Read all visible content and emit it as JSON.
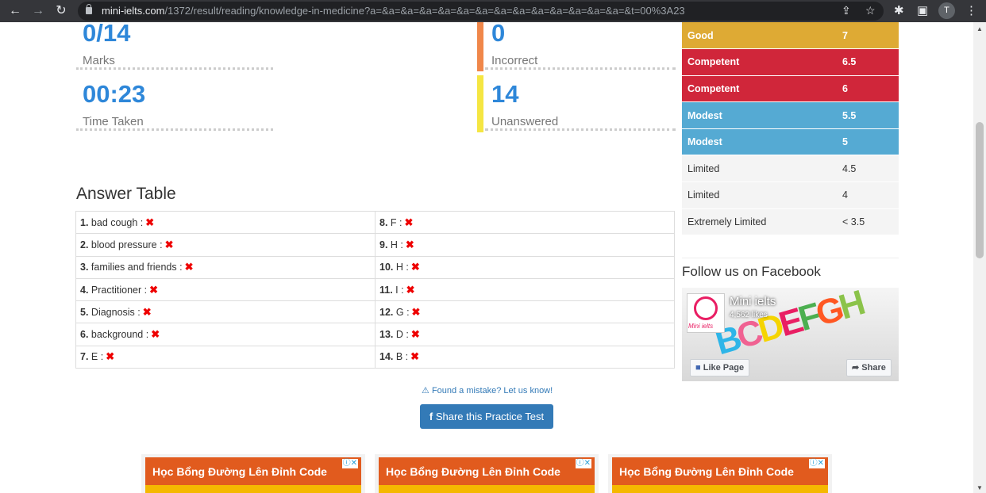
{
  "browser": {
    "url_domain": "mini-ielts.com",
    "url_path": "/1372/result/reading/knowledge-in-medicine?a=&a=&a=&a=&a=&a=&a=&a=&a=&a=&a=&a=&a=&a=&t=00%3A23",
    "avatar_letter": "T"
  },
  "stats": {
    "marks": {
      "value": "0/14",
      "label": "Marks"
    },
    "time": {
      "value": "00:23",
      "label": "Time Taken"
    },
    "incorrect": {
      "value": "0",
      "label": "Incorrect",
      "color": "#f0874a"
    },
    "unanswered": {
      "value": "14",
      "label": "Unanswered",
      "color": "#f5e642"
    }
  },
  "answer_table": {
    "title": "Answer Table",
    "left": [
      {
        "num": "1.",
        "answer": "bad cough :"
      },
      {
        "num": "2.",
        "answer": "blood pressure :"
      },
      {
        "num": "3.",
        "answer": "families and friends :"
      },
      {
        "num": "4.",
        "answer": "Practitioner :"
      },
      {
        "num": "5.",
        "answer": "Diagnosis :"
      },
      {
        "num": "6.",
        "answer": "background :"
      },
      {
        "num": "7.",
        "answer": "E :"
      }
    ],
    "right": [
      {
        "num": "8.",
        "answer": "F :"
      },
      {
        "num": "9.",
        "answer": "H :"
      },
      {
        "num": "10.",
        "answer": "H :"
      },
      {
        "num": "11.",
        "answer": "I :"
      },
      {
        "num": "12.",
        "answer": "G :"
      },
      {
        "num": "13.",
        "answer": "D :"
      },
      {
        "num": "14.",
        "answer": "B :"
      }
    ]
  },
  "mistake_link": "Found a mistake? Let us know!",
  "share_button": "Share this Practice Test",
  "bands": [
    {
      "level": "Good",
      "score": "7",
      "bg": "#deaa34",
      "fg": "#ffffff"
    },
    {
      "level": "Competent",
      "score": "6.5",
      "bg": "#d0263a",
      "fg": "#ffffff"
    },
    {
      "level": "Competent",
      "score": "6",
      "bg": "#d0263a",
      "fg": "#ffffff"
    },
    {
      "level": "Modest",
      "score": "5.5",
      "bg": "#55aad3",
      "fg": "#ffffff"
    },
    {
      "level": "Modest",
      "score": "5",
      "bg": "#55aad3",
      "fg": "#ffffff"
    },
    {
      "level": "Limited",
      "score": "4.5",
      "bg": "#f4f4f4",
      "fg": "#333333"
    },
    {
      "level": "Limited",
      "score": "4",
      "bg": "#f4f4f4",
      "fg": "#333333"
    },
    {
      "level": "Extremely Limited",
      "score": "< 3.5",
      "bg": "#f4f4f4",
      "fg": "#333333"
    }
  ],
  "facebook": {
    "heading": "Follow us on Facebook",
    "page_name": "Mini ielts",
    "likes": "4,562 likes",
    "logo_text": "Mini ielts",
    "like_button": "Like Page",
    "share_button": "Share",
    "banner_letters": "BCDEFGH"
  },
  "ads": [
    {
      "title": "Học Bổng Đường Lên Đỉnh Code"
    },
    {
      "title": "Học Bổng Đường Lên Đỉnh Code"
    },
    {
      "title": "Học Bổng Đường Lên Đỉnh Code"
    }
  ]
}
